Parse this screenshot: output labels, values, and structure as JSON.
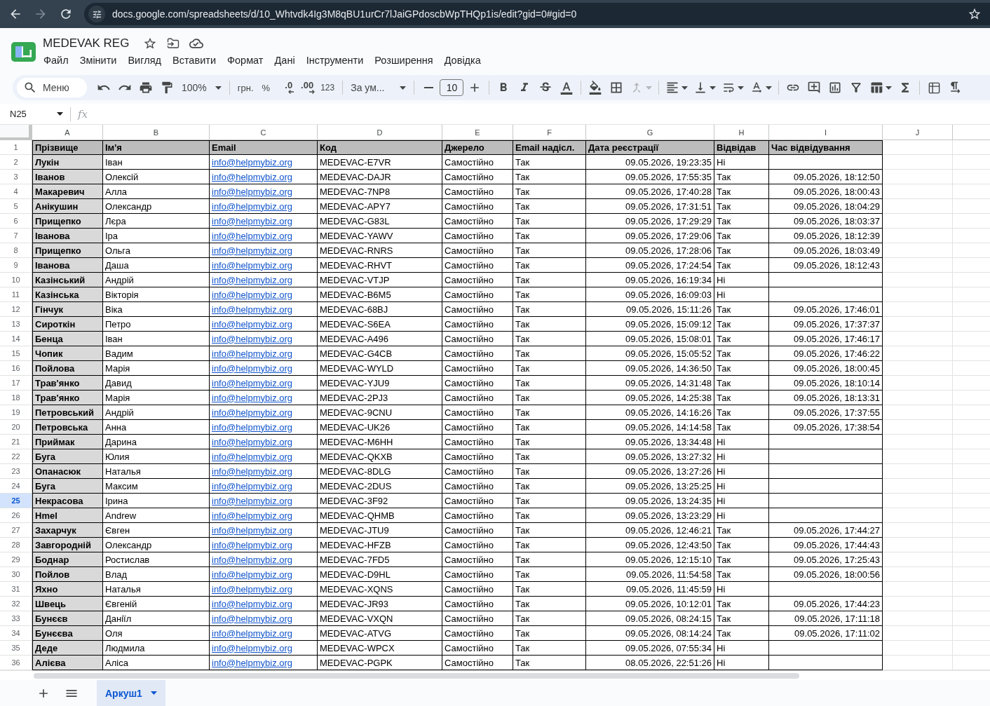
{
  "browser": {
    "navigation": [
      {
        "kind": "back",
        "disabled": false
      },
      {
        "kind": "forward",
        "disabled": true
      },
      {
        "kind": "reload",
        "disabled": false
      }
    ],
    "url": "docs.google.com/spreadsheets/d/10_Whtvdk4Ig3M8qBU1urCr7lJaiGPdoscbWpTHQp1is/edit?gid=0#gid=0"
  },
  "document": {
    "title": "MEDEVAK REG"
  },
  "menu": [
    "Файл",
    "Змінити",
    "Вигляд",
    "Вставити",
    "Формат",
    "Дані",
    "Інструменти",
    "Розширення",
    "Довідка"
  ],
  "toolbar": {
    "search_placeholder": "Меню",
    "zoom": "100%",
    "currency": "грн.",
    "percent": "%",
    "decimal_decrease": ".0",
    "decimal_increase": ".00",
    "more_formats": "123",
    "font": "За ум...",
    "font_size": "10",
    "merge_disabled": true
  },
  "formula_bar": {
    "name_box": "N25",
    "fx": "fx"
  },
  "columns": [
    "A",
    "B",
    "C",
    "D",
    "E",
    "F",
    "G",
    "H",
    "I",
    "J"
  ],
  "header_row": {
    "number": "1",
    "selected": false,
    "cells": [
      "Прізвище",
      "Ім'я",
      "Email",
      "Код",
      "Джерело",
      "Email надісл.",
      "Дата реєстрації",
      "Відвідав",
      "Час відвідування"
    ]
  },
  "rows": [
    {
      "number": "2",
      "selected": false,
      "surname": "Лукін",
      "first_name": "Іван",
      "email": "info@helpmybiz.org",
      "code": "MEDEVAC-E7VR",
      "source": "Самостійно",
      "email_sent": "Так",
      "registered": "09.05.2026, 19:23:35",
      "attended": "Ні"
    },
    {
      "number": "3",
      "selected": false,
      "surname": "Іванов",
      "first_name": "Олексій",
      "email": "info@helpmybiz.org",
      "code": "MEDEVAC-DAJR",
      "source": "Самостійно",
      "email_sent": "Так",
      "registered": "09.05.2026, 17:55:35",
      "attended": "Так",
      "attended_time": "09.05.2026, 18:12:50"
    },
    {
      "number": "4",
      "selected": false,
      "surname": "Макаревич",
      "first_name": "Алла",
      "email": "info@helpmybiz.org",
      "code": "MEDEVAC-7NP8",
      "source": "Самостійно",
      "email_sent": "Так",
      "registered": "09.05.2026, 17:40:28",
      "attended": "Так",
      "attended_time": "09.05.2026, 18:00:43"
    },
    {
      "number": "5",
      "selected": false,
      "surname": "Анікушин",
      "first_name": "Олександр",
      "email": "info@helpmybiz.org",
      "code": "MEDEVAC-APY7",
      "source": "Самостійно",
      "email_sent": "Так",
      "registered": "09.05.2026, 17:31:51",
      "attended": "Так",
      "attended_time": "09.05.2026, 18:04:29"
    },
    {
      "number": "6",
      "selected": false,
      "surname": "Прищепко",
      "first_name": "Лєра",
      "email": "info@helpmybiz.org",
      "code": "MEDEVAC-G83L",
      "source": "Самостійно",
      "email_sent": "Так",
      "registered": "09.05.2026, 17:29:29",
      "attended": "Так",
      "attended_time": "09.05.2026, 18:03:37"
    },
    {
      "number": "7",
      "selected": false,
      "surname": "Іванова",
      "first_name": "Іра",
      "email": "info@helpmybiz.org",
      "code": "MEDEVAC-YAWV",
      "source": "Самостійно",
      "email_sent": "Так",
      "registered": "09.05.2026, 17:29:06",
      "attended": "Так",
      "attended_time": "09.05.2026, 18:12:39"
    },
    {
      "number": "8",
      "selected": false,
      "surname": "Прищепко",
      "first_name": "Ольга",
      "email": "info@helpmybiz.org",
      "code": "MEDEVAC-RNRS",
      "source": "Самостійно",
      "email_sent": "Так",
      "registered": "09.05.2026, 17:28:06",
      "attended": "Так",
      "attended_time": "09.05.2026, 18:03:49"
    },
    {
      "number": "9",
      "selected": false,
      "surname": "Іванова",
      "first_name": "Даша",
      "email": "info@helpmybiz.org",
      "code": "MEDEVAC-RHVT",
      "source": "Самостійно",
      "email_sent": "Так",
      "registered": "09.05.2026, 17:24:54",
      "attended": "Так",
      "attended_time": "09.05.2026, 18:12:43"
    },
    {
      "number": "10",
      "selected": false,
      "surname": "Казінський",
      "first_name": "Андрій",
      "email": "info@helpmybiz.org",
      "code": "MEDEVAC-VTJP",
      "source": "Самостійно",
      "email_sent": "Так",
      "registered": "09.05.2026, 16:19:34",
      "attended": "Ні"
    },
    {
      "number": "11",
      "selected": false,
      "surname": "Казінська",
      "first_name": "Вікторія",
      "email": "info@helpmybiz.org",
      "code": "MEDEVAC-B6M5",
      "source": "Самостійно",
      "email_sent": "Так",
      "registered": "09.05.2026, 16:09:03",
      "attended": "Ні"
    },
    {
      "number": "12",
      "selected": false,
      "surname": "Гінчук",
      "first_name": "Віка",
      "email": "info@helpmybiz.org",
      "code": "MEDEVAC-68BJ",
      "source": "Самостійно",
      "email_sent": "Так",
      "registered": "09.05.2026, 15:11:26",
      "attended": "Так",
      "attended_time": "09.05.2026, 17:46:01"
    },
    {
      "number": "13",
      "selected": false,
      "surname": "Сироткін",
      "first_name": "Петро",
      "email": "info@helpmybiz.org",
      "code": "MEDEVAC-S6EA",
      "source": "Самостійно",
      "email_sent": "Так",
      "registered": "09.05.2026, 15:09:12",
      "attended": "Так",
      "attended_time": "09.05.2026, 17:37:37"
    },
    {
      "number": "14",
      "selected": false,
      "surname": "Бенца",
      "first_name": "Іван",
      "email": "info@helpmybiz.org",
      "code": "MEDEVAC-A496",
      "source": "Самостійно",
      "email_sent": "Так",
      "registered": "09.05.2026, 15:08:01",
      "attended": "Так",
      "attended_time": "09.05.2026, 17:46:17"
    },
    {
      "number": "15",
      "selected": false,
      "surname": "Чопик",
      "first_name": "Вадим",
      "email": "info@helpmybiz.org",
      "code": "MEDEVAC-G4CB",
      "source": "Самостійно",
      "email_sent": "Так",
      "registered": "09.05.2026, 15:05:52",
      "attended": "Так",
      "attended_time": "09.05.2026, 17:46:22"
    },
    {
      "number": "16",
      "selected": false,
      "surname": "Пойлова",
      "first_name": "Марія",
      "email": "info@helpmybiz.org",
      "code": "MEDEVAC-WYLD",
      "source": "Самостійно",
      "email_sent": "Так",
      "registered": "09.05.2026, 14:36:50",
      "attended": "Так",
      "attended_time": "09.05.2026, 18:00:45"
    },
    {
      "number": "17",
      "selected": false,
      "surname": "Трав'янко",
      "first_name": "Давид",
      "email": "info@helpmybiz.org",
      "code": "MEDEVAC-YJU9",
      "source": "Самостійно",
      "email_sent": "Так",
      "registered": "09.05.2026, 14:31:48",
      "attended": "Так",
      "attended_time": "09.05.2026, 18:10:14"
    },
    {
      "number": "18",
      "selected": false,
      "surname": "Трав'янко",
      "first_name": "Марія",
      "email": "info@helpmybiz.org",
      "code": "MEDEVAC-2PJ3",
      "source": "Самостійно",
      "email_sent": "Так",
      "registered": "09.05.2026, 14:25:38",
      "attended": "Так",
      "attended_time": "09.05.2026, 18:13:31"
    },
    {
      "number": "19",
      "selected": false,
      "surname": "Петровський",
      "first_name": "Андрій",
      "email": "info@helpmybiz.org",
      "code": "MEDEVAC-9CNU",
      "source": "Самостійно",
      "email_sent": "Так",
      "registered": "09.05.2026, 14:16:26",
      "attended": "Так",
      "attended_time": "09.05.2026, 17:37:55"
    },
    {
      "number": "20",
      "selected": false,
      "surname": "Петровська",
      "first_name": "Анна",
      "email": "info@helpmybiz.org",
      "code": "MEDEVAC-UK26",
      "source": "Самостійно",
      "email_sent": "Так",
      "registered": "09.05.2026, 14:14:58",
      "attended": "Так",
      "attended_time": "09.05.2026, 17:38:54"
    },
    {
      "number": "21",
      "selected": false,
      "surname": "Приймак",
      "first_name": "Дарина",
      "email": "info@helpmybiz.org",
      "code": "MEDEVAC-M6HH",
      "source": "Самостійно",
      "email_sent": "Так",
      "registered": "09.05.2026, 13:34:48",
      "attended": "Ні"
    },
    {
      "number": "22",
      "selected": false,
      "surname": "Буга",
      "first_name": "Юлия",
      "email": "info@helpmybiz.org",
      "code": "MEDEVAC-QKXB",
      "source": "Самостійно",
      "email_sent": "Так",
      "registered": "09.05.2026, 13:27:32",
      "attended": "Ні"
    },
    {
      "number": "23",
      "selected": false,
      "surname": "Опанасюк",
      "first_name": "Наталья",
      "email": "info@helpmybiz.org",
      "code": "MEDEVAC-8DLG",
      "source": "Самостійно",
      "email_sent": "Так",
      "registered": "09.05.2026, 13:27:26",
      "attended": "Ні"
    },
    {
      "number": "24",
      "selected": false,
      "surname": "Буга",
      "first_name": "Максим",
      "email": "info@helpmybiz.org",
      "code": "MEDEVAC-2DUS",
      "source": "Самостійно",
      "email_sent": "Так",
      "registered": "09.05.2026, 13:25:25",
      "attended": "Ні"
    },
    {
      "number": "25",
      "selected": true,
      "surname": "Некрасова",
      "first_name": "Ірина",
      "email": "info@helpmybiz.org",
      "code": "MEDEVAC-3F92",
      "source": "Самостійно",
      "email_sent": "Так",
      "registered": "09.05.2026, 13:24:35",
      "attended": "Ні"
    },
    {
      "number": "26",
      "selected": false,
      "surname": "Hmel",
      "first_name": "Andrew",
      "email": "info@helpmybiz.org",
      "code": "MEDEVAC-QHMB",
      "source": "Самостійно",
      "email_sent": "Так",
      "registered": "09.05.2026, 13:23:29",
      "attended": "Ні"
    },
    {
      "number": "27",
      "selected": false,
      "surname": "Захарчук",
      "first_name": "Євген",
      "email": "info@helpmybiz.org",
      "code": "MEDEVAC-JTU9",
      "source": "Самостійно",
      "email_sent": "Так",
      "registered": "09.05.2026, 12:46:21",
      "attended": "Так",
      "attended_time": "09.05.2026, 17:44:27"
    },
    {
      "number": "28",
      "selected": false,
      "surname": "Завгородній",
      "first_name": "Олександр",
      "email": "info@helpmybiz.org",
      "code": "MEDEVAC-HFZB",
      "source": "Самостійно",
      "email_sent": "Так",
      "registered": "09.05.2026, 12:43:50",
      "attended": "Так",
      "attended_time": "09.05.2026, 17:44:43"
    },
    {
      "number": "29",
      "selected": false,
      "surname": "Боднар",
      "first_name": "Ростислав",
      "email": "info@helpmybiz.org",
      "code": "MEDEVAC-7FD5",
      "source": "Самостійно",
      "email_sent": "Так",
      "registered": "09.05.2026, 12:15:10",
      "attended": "Так",
      "attended_time": "09.05.2026, 17:25:43"
    },
    {
      "number": "30",
      "selected": false,
      "surname": "Пойлов",
      "first_name": "Влад",
      "email": "info@helpmybiz.org",
      "code": "MEDEVAC-D9HL",
      "source": "Самостійно",
      "email_sent": "Так",
      "registered": "09.05.2026, 11:54:58",
      "attended": "Так",
      "attended_time": "09.05.2026, 18:00:56"
    },
    {
      "number": "31",
      "selected": false,
      "surname": "Яхно",
      "first_name": "Наталья",
      "email": "info@helpmybiz.org",
      "code": "MEDEVAC-XQNS",
      "source": "Самостійно",
      "email_sent": "Так",
      "registered": "09.05.2026, 11:45:59",
      "attended": "Ні"
    },
    {
      "number": "32",
      "selected": false,
      "surname": "Швець",
      "first_name": "Євгеній",
      "email": "info@helpmybiz.org",
      "code": "MEDEVAC-JR93",
      "source": "Самостійно",
      "email_sent": "Так",
      "registered": "09.05.2026, 10:12:01",
      "attended": "Так",
      "attended_time": "09.05.2026, 17:44:23"
    },
    {
      "number": "33",
      "selected": false,
      "surname": "Бунєєв",
      "first_name": "Даніїл",
      "email": "info@helpmybiz.org",
      "code": "MEDEVAC-VXQN",
      "source": "Самостійно",
      "email_sent": "Так",
      "registered": "09.05.2026, 08:24:15",
      "attended": "Так",
      "attended_time": "09.05.2026, 17:11:18"
    },
    {
      "number": "34",
      "selected": false,
      "surname": "Бунєєва",
      "first_name": "Оля",
      "email": "info@helpmybiz.org",
      "code": "MEDEVAC-ATVG",
      "source": "Самостійно",
      "email_sent": "Так",
      "registered": "09.05.2026, 08:14:24",
      "attended": "Так",
      "attended_time": "09.05.2026, 17:11:02"
    },
    {
      "number": "35",
      "selected": false,
      "surname": "Деде",
      "first_name": "Людмила",
      "email": "info@helpmybiz.org",
      "code": "MEDEVAC-WPCX",
      "source": "Самостійно",
      "email_sent": "Так",
      "registered": "09.05.2026, 07:55:34",
      "attended": "Ні"
    },
    {
      "number": "36",
      "selected": false,
      "surname": "Алієва",
      "first_name": "Аліса",
      "email": "info@helpmybiz.org",
      "code": "MEDEVAC-PGPK",
      "source": "Самостійно",
      "email_sent": "Так",
      "registered": "08.05.2026, 22:51:26",
      "attended": "Ні"
    }
  ],
  "sheet_tabs": [
    {
      "label": "Аркуш1",
      "selected": true
    }
  ]
}
